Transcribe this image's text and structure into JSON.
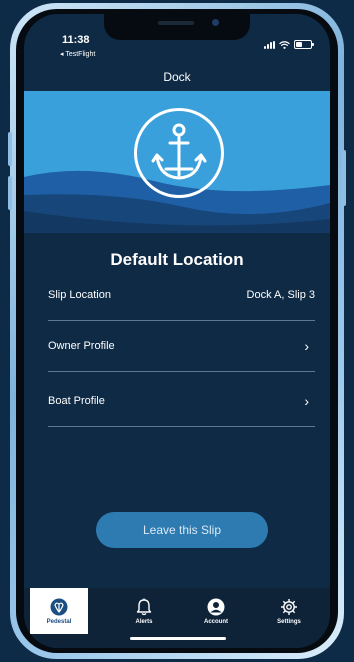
{
  "status_bar": {
    "time": "11:38",
    "back_label": "◂ TestFlight"
  },
  "nav": {
    "title": "Dock"
  },
  "location": {
    "title": "Default Location"
  },
  "rows": [
    {
      "label": "Slip Location",
      "value": "Dock A, Slip 3"
    },
    {
      "label": "Owner Profile",
      "chevron": "›"
    },
    {
      "label": "Boat Profile",
      "chevron": "›"
    }
  ],
  "actions": {
    "leave_label": "Leave this Slip"
  },
  "tabs": [
    {
      "label": "Pedestal",
      "icon": "pedestal-icon",
      "active": true
    },
    {
      "label": "Alerts",
      "icon": "bell-icon"
    },
    {
      "label": "Account",
      "icon": "account-icon"
    },
    {
      "label": "Settings",
      "icon": "gear-icon"
    }
  ],
  "colors": {
    "background": "#0d2a47",
    "screen": "#0f2a44",
    "hero_sky": "#3aa0dc",
    "hero_wave": "#1e5fa6",
    "button": "#2d7bb0",
    "tabbar": "#0e2238"
  }
}
